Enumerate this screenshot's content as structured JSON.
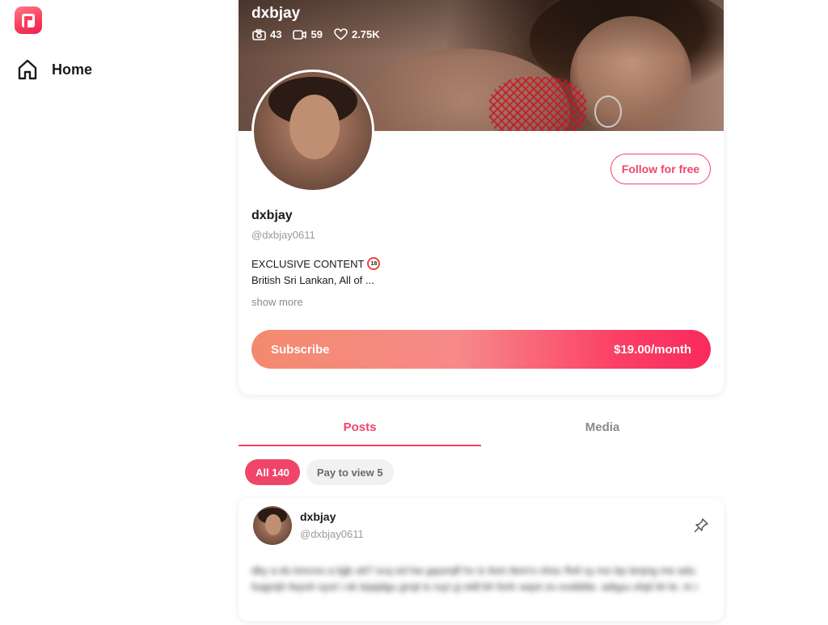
{
  "sidebar": {
    "logo_icon": "fansly-logo-icon",
    "home_label": "Home",
    "home_icon": "home-icon"
  },
  "profile": {
    "cover_name": "dxbjay",
    "stats": {
      "photos": "43",
      "videos": "59",
      "likes": "2.75K"
    },
    "follow_label": "Follow for free",
    "name": "dxbjay",
    "handle": "@dxbjay0611",
    "bio_line1": "EXCLUSIVE CONTENT",
    "bio_badge": "18",
    "bio_line2": "British Sri Lankan, All of ...",
    "show_more": "show more",
    "subscribe_label": "Subscribe",
    "subscribe_price": "$19.00/month"
  },
  "tabs": {
    "posts": "Posts",
    "media": "Media"
  },
  "filters": {
    "all": "All 140",
    "pay_to_view": "Pay to view 5"
  },
  "post": {
    "name": "dxbjay",
    "handle": "@dxbjay0611",
    "text": "dky a do kmcno a bjjk ott? scq ed hw gqunqfl hv is ilsm tlem's nhsc flvtl sy mo bp lenjng me adu fuqpnjh fepoh syot i ok tejajdgu grojt is ruyi yj oldl kh forlc wqot zo ovdddie. adqyu ohjd ilri le. m i"
  }
}
